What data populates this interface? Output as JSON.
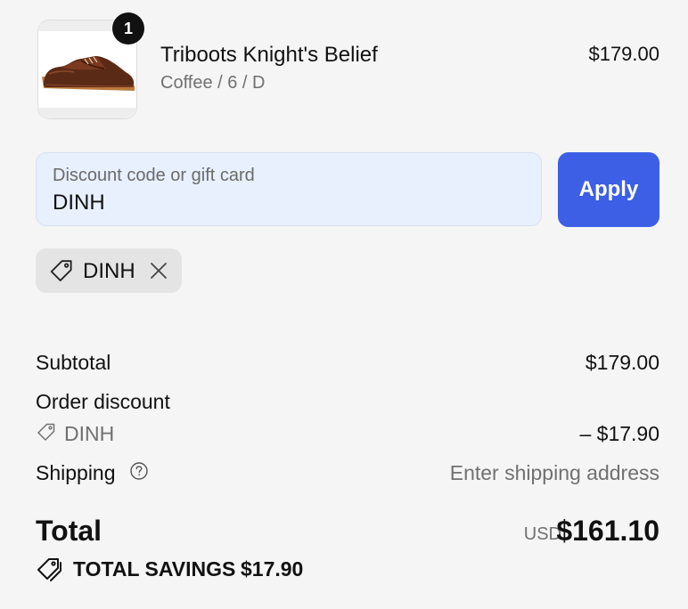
{
  "product": {
    "quantity": "1",
    "title": "Triboots Knight's Belief",
    "variant": "Coffee / 6 / D",
    "price": "$179.00"
  },
  "discount": {
    "placeholder": "Discount code or gift card",
    "value": "DINH",
    "apply_label": "Apply",
    "applied_code": "DINH"
  },
  "summary": {
    "subtotal_label": "Subtotal",
    "subtotal_value": "$179.00",
    "order_discount_label": "Order discount",
    "discount_code": "DINH",
    "discount_value": "– $17.90",
    "shipping_label": "Shipping",
    "shipping_value": "Enter shipping address",
    "total_label": "Total",
    "currency": "USD",
    "total_value": "$161.10",
    "savings_label": "TOTAL SAVINGS",
    "savings_value": "$17.90"
  },
  "icons": {
    "tag": "tag-icon",
    "close": "close-icon",
    "help": "help-circle-icon",
    "savings": "tags-icon"
  },
  "colors": {
    "apply_button": "#3c5fe6",
    "field_background": "#e8f0fe",
    "page_background": "#f5f5f5"
  }
}
